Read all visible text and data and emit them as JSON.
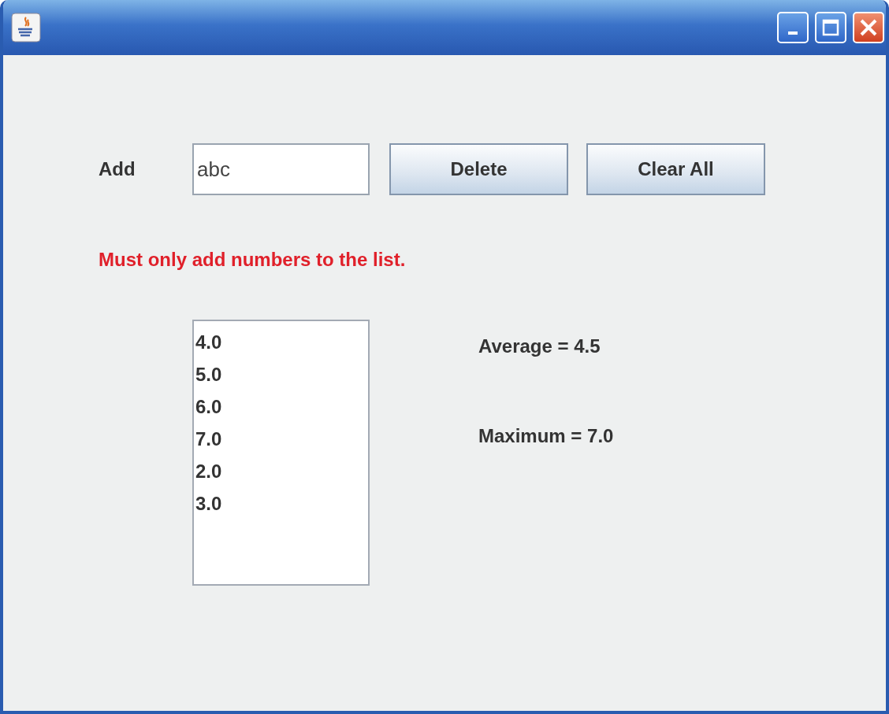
{
  "add_field": {
    "label": "Add",
    "value": "abc"
  },
  "buttons": [
    "Delete",
    "Clear All"
  ],
  "error_message": "Must only add numbers to the list.",
  "list": {
    "items": [
      "4.0",
      "5.0",
      "6.0",
      "7.0",
      "2.0",
      "3.0"
    ]
  },
  "stats": [
    "Average = 4.5",
    "Maximum = 7.0"
  ]
}
